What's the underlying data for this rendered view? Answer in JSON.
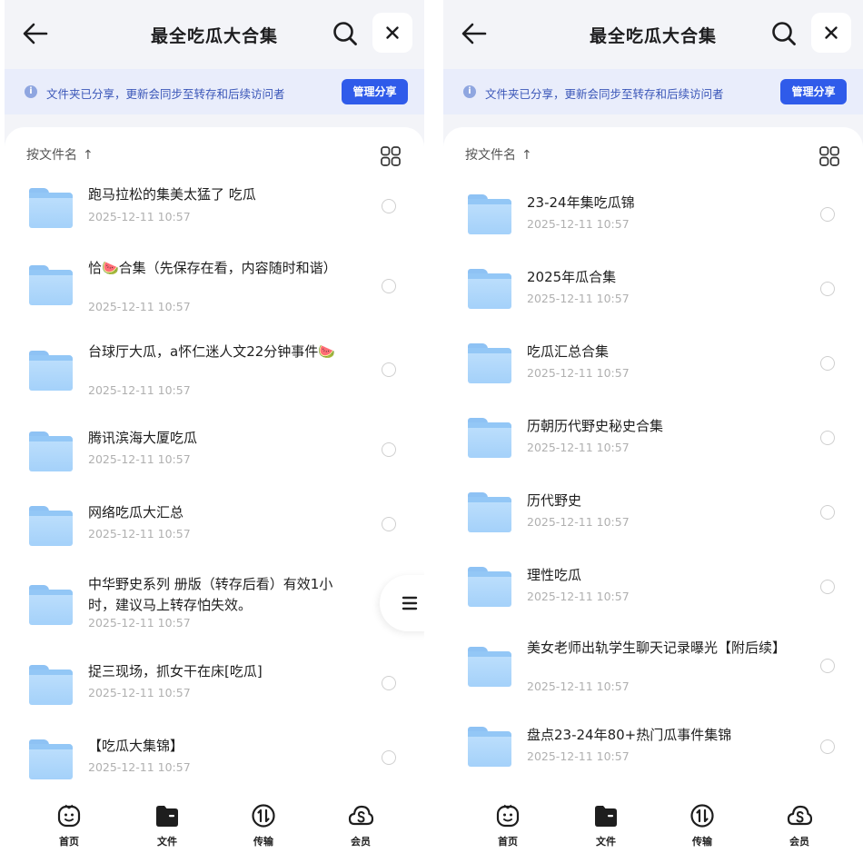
{
  "screens": [
    {
      "header": {
        "title": "最全吃瓜大合集"
      },
      "notice": {
        "text": "文件夹已分享，更新会同步至转存和后续访问者",
        "button": "管理分享"
      },
      "sort": {
        "label": "按文件名",
        "arrow": "↑"
      },
      "files": [
        {
          "name": "跑马拉松的集美太猛了 吃瓜",
          "date": "2025-12-11 10:57"
        },
        {
          "name": "恰🍉合集（先保存在看，内容随时和谐）",
          "date": "2025-12-11 10:57"
        },
        {
          "name": "台球厅大瓜，a怀仁迷人文22分钟事件🍉",
          "date": "2025-12-11 10:57"
        },
        {
          "name": "腾讯滨海大厦吃瓜",
          "date": "2025-12-11 10:57"
        },
        {
          "name": "网络吃瓜大汇总",
          "date": "2025-12-11 10:57"
        },
        {
          "name": "中华野史系列 册版（转存后看）有效1小时，建议马上转存怕失效。",
          "date": "2025-12-11 10:57"
        },
        {
          "name": "捉三现场，抓女干在床[吃瓜]",
          "date": "2025-12-11 10:57"
        },
        {
          "name": "【吃瓜大集锦】",
          "date": "2025-12-11 10:57"
        }
      ],
      "tabs": [
        {
          "label": "首页",
          "icon": "smile-face-icon"
        },
        {
          "label": "文件",
          "icon": "folder-icon"
        },
        {
          "label": "传输",
          "icon": "transfer-icon"
        },
        {
          "label": "会员",
          "icon": "cloud-s-icon"
        }
      ]
    },
    {
      "header": {
        "title": "最全吃瓜大合集"
      },
      "notice": {
        "text": "文件夹已分享，更新会同步至转存和后续访问者",
        "button": "管理分享"
      },
      "sort": {
        "label": "按文件名",
        "arrow": "↑"
      },
      "files": [
        {
          "name": "23-24年集吃瓜锦",
          "date": "2025-12-11 10:57"
        },
        {
          "name": "2025年瓜合集",
          "date": "2025-12-11 10:57"
        },
        {
          "name": "吃瓜汇总合集",
          "date": "2025-12-11 10:57"
        },
        {
          "name": "历朝历代野史秘史合集",
          "date": "2025-12-11 10:57"
        },
        {
          "name": "历代野史",
          "date": "2025-12-11 10:57"
        },
        {
          "name": "理性吃瓜",
          "date": "2025-12-11 10:57"
        },
        {
          "name": "美女老师出轨学生聊天记录曝光【附后续】",
          "date": "2025-12-11 10:57"
        },
        {
          "name": "盘点23-24年80+热门瓜事件集锦",
          "date": "2025-12-11 10:57"
        }
      ],
      "tabs": [
        {
          "label": "首页",
          "icon": "smile-face-icon"
        },
        {
          "label": "文件",
          "icon": "folder-icon"
        },
        {
          "label": "传输",
          "icon": "transfer-icon"
        },
        {
          "label": "会员",
          "icon": "cloud-s-icon"
        }
      ]
    }
  ]
}
